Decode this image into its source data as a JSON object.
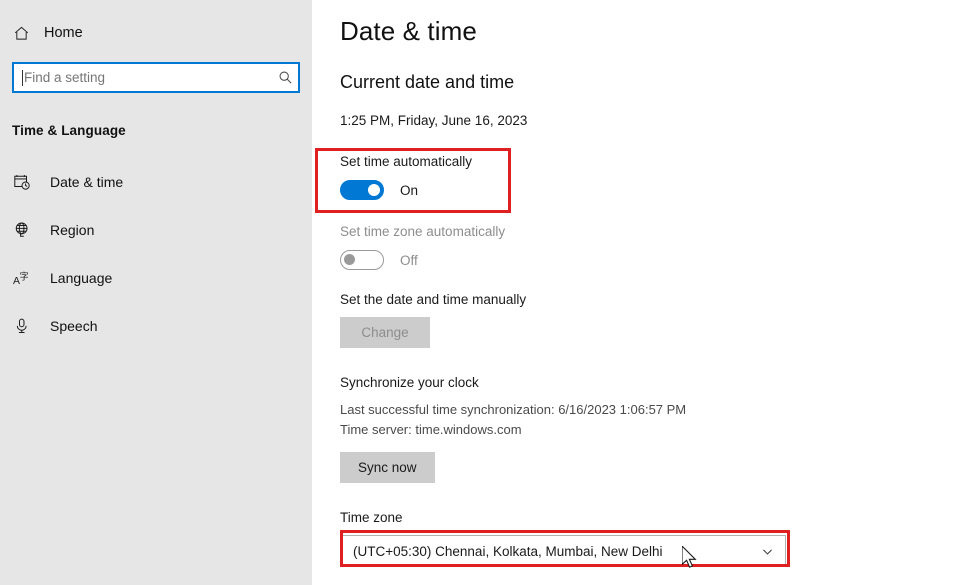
{
  "sidebar": {
    "home": {
      "label": "Home",
      "icon": "home-icon"
    },
    "search": {
      "placeholder": "Find a setting",
      "value": "",
      "icon": "search-icon"
    },
    "section_title": "Time & Language",
    "items": [
      {
        "label": "Date & time",
        "icon": "calendar-clock-icon"
      },
      {
        "label": "Region",
        "icon": "globe-icon"
      },
      {
        "label": "Language",
        "icon": "language-icon"
      },
      {
        "label": "Speech",
        "icon": "microphone-icon"
      }
    ]
  },
  "content": {
    "page_title": "Date & time",
    "current_heading": "Current date and time",
    "current_datetime": "1:25 PM, Friday, June 16, 2023",
    "set_time_auto": {
      "label": "Set time automatically",
      "state": "On",
      "enabled": true
    },
    "set_timezone_auto": {
      "label": "Set time zone automatically",
      "state": "Off",
      "enabled": false
    },
    "manual": {
      "label": "Set the date and time manually",
      "button": "Change",
      "button_enabled": false
    },
    "sync": {
      "heading": "Synchronize your clock",
      "last_sync": "Last successful time synchronization: 6/16/2023 1:06:57 PM",
      "time_server": "Time server: time.windows.com",
      "button": "Sync now"
    },
    "timezone": {
      "label": "Time zone",
      "value": "(UTC+05:30) Chennai, Kolkata, Mumbai, New Delhi",
      "chevron": "chevron-down-icon"
    }
  },
  "annotations": {
    "highlight_color": "#e02020",
    "boxes": [
      {
        "name": "set-time-automatically-highlight"
      },
      {
        "name": "timezone-dropdown-highlight"
      }
    ]
  },
  "colors": {
    "accent": "#0078d4",
    "sidebar_bg": "#e6e6e6",
    "content_bg": "#ffffff",
    "button_bg": "#cccccc",
    "highlight": "#e02020"
  }
}
